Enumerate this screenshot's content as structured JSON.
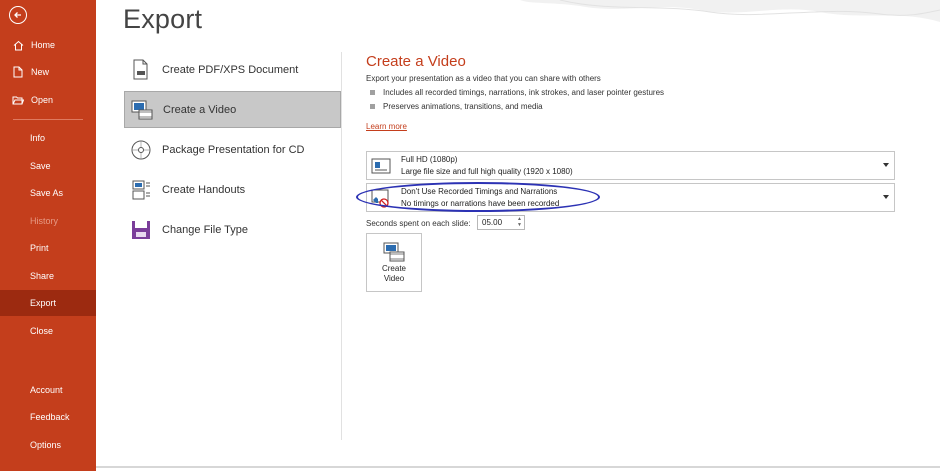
{
  "sidebar": {
    "back_icon": "back-arrow-icon",
    "items": [
      {
        "label": "Home",
        "icon": "home-icon"
      },
      {
        "label": "New",
        "icon": "new-document-icon"
      },
      {
        "label": "Open",
        "icon": "open-folder-icon"
      },
      {
        "label": "Info"
      },
      {
        "label": "Save"
      },
      {
        "label": "Save As"
      },
      {
        "label": "History",
        "disabled": true
      },
      {
        "label": "Print"
      },
      {
        "label": "Share"
      },
      {
        "label": "Export",
        "active": true
      },
      {
        "label": "Close"
      },
      {
        "label": "Account"
      },
      {
        "label": "Feedback"
      },
      {
        "label": "Options"
      }
    ]
  },
  "page": {
    "title": "Export"
  },
  "export_options": [
    {
      "label": "Create PDF/XPS Document",
      "icon": "pdf-document-icon"
    },
    {
      "label": "Create a Video",
      "icon": "video-icon",
      "selected": true
    },
    {
      "label": "Package Presentation for CD",
      "icon": "cd-icon"
    },
    {
      "label": "Create Handouts",
      "icon": "handouts-icon"
    },
    {
      "label": "Change File Type",
      "icon": "file-type-icon"
    }
  ],
  "video_panel": {
    "title": "Create a Video",
    "description": "Export your presentation as a video that you can share with others",
    "bullets": [
      "Includes all recorded timings, narrations, ink strokes, and laser pointer gestures",
      "Preserves animations, transitions, and media"
    ],
    "learn_more": "Learn more",
    "quality_dropdown": {
      "line1": "Full HD (1080p)",
      "line2": "Large file size and full high quality (1920 x 1080)",
      "icon": "resolution-icon"
    },
    "timings_dropdown": {
      "line1": "Don't Use Recorded Timings and Narrations",
      "line2": "No timings or narrations have been recorded",
      "icon": "no-narration-icon"
    },
    "seconds_label": "Seconds spent on each slide:",
    "seconds_value": "05.00",
    "create_button": {
      "line1": "Create",
      "line2": "Video",
      "icon": "create-video-icon"
    }
  },
  "colors": {
    "accent": "#c43e1c",
    "sidebar_active": "#9c2a10",
    "annotation": "#2c32b4"
  }
}
